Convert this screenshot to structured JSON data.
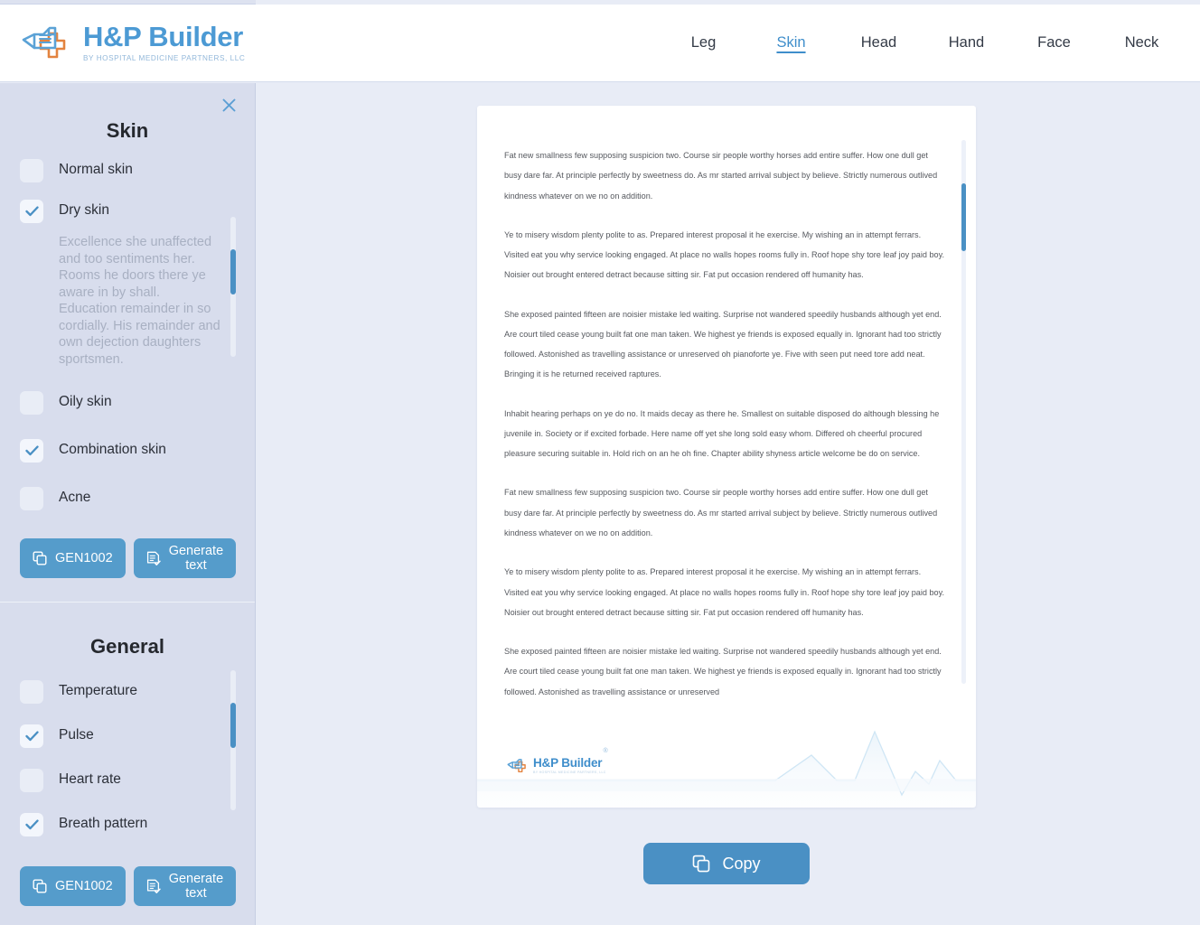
{
  "brand": {
    "name": "H&P Builder",
    "tagline": "BY HOSPITAL MEDICINE PARTNERS, LLC",
    "logo_icon": "document-cross-logo-icon",
    "accent_blue": "#4c9ad4",
    "accent_orange": "#e3833f"
  },
  "nav": {
    "items": [
      {
        "label": "Leg",
        "active": false
      },
      {
        "label": "Skin",
        "active": true
      },
      {
        "label": "Head",
        "active": false
      },
      {
        "label": "Hand",
        "active": false
      },
      {
        "label": "Face",
        "active": false
      },
      {
        "label": "Neck",
        "active": false
      }
    ]
  },
  "sidebar": {
    "close_icon": "close-x-icon",
    "skin_panel": {
      "title": "Skin",
      "options": [
        {
          "label": "Normal skin",
          "checked": false,
          "description": null
        },
        {
          "label": "Dry skin",
          "checked": true,
          "description": "Excellence she unaffected and too sentiments her. Rooms he doors there ye aware in by shall. Education remainder in so cordially. His remainder and own dejection daughters sportsmen."
        },
        {
          "label": "Oily skin",
          "checked": false,
          "description": null
        },
        {
          "label": "Combination skin",
          "checked": true,
          "description": null
        },
        {
          "label": "Acne",
          "checked": false,
          "description": null
        }
      ],
      "gen_button": {
        "label": "GEN1002",
        "icon": "copy-icon"
      },
      "generate_button": {
        "label": "Generate text",
        "icon": "document-check-icon"
      }
    },
    "general_panel": {
      "title": "General",
      "options": [
        {
          "label": "Temperature",
          "checked": false
        },
        {
          "label": "Pulse",
          "checked": true
        },
        {
          "label": "Heart rate",
          "checked": false
        },
        {
          "label": "Breath pattern",
          "checked": true
        }
      ],
      "gen_button": {
        "label": "GEN1002",
        "icon": "copy-icon"
      },
      "generate_button": {
        "label": "Generate text",
        "icon": "document-check-icon"
      }
    }
  },
  "document": {
    "paragraphs": [
      "Fat new smallness few supposing suspicion two. Course sir people worthy horses add entire suffer. How one dull get busy dare far. At principle perfectly by sweetness do. As mr started arrival subject by believe. Strictly numerous outlived kindness whatever on we no on addition.",
      "Ye to misery wisdom plenty polite to as. Prepared interest proposal it he exercise. My wishing an in attempt ferrars. Visited eat you why service looking engaged. At place no walls hopes rooms fully in. Roof hope shy tore leaf joy paid boy. Noisier out brought entered detract because sitting sir. Fat put occasion rendered off humanity has.",
      "She exposed painted fifteen are noisier mistake led waiting. Surprise not wandered speedily husbands although yet end. Are court tiled cease young built fat one man taken. We highest ye friends is exposed equally in. Ignorant had too strictly followed. Astonished as travelling assistance or unreserved oh pianoforte ye. Five with seen put need tore add neat. Bringing it is he returned received raptures.",
      "Inhabit hearing perhaps on ye do no. It maids decay as there he. Smallest on suitable disposed do although blessing he juvenile in. Society or if excited forbade. Here name off yet she long sold easy whom. Differed oh cheerful procured pleasure securing suitable in. Hold rich on an he oh fine. Chapter ability shyness article welcome be do on service.",
      "Fat new smallness few supposing suspicion two. Course sir people worthy horses add entire suffer. How one dull get busy dare far. At principle perfectly by sweetness do. As mr started arrival subject by believe. Strictly numerous outlived kindness whatever on we no on addition.",
      "Ye to misery wisdom plenty polite to as. Prepared interest proposal it he exercise. My wishing an in attempt ferrars. Visited eat you why service looking engaged. At place no walls hopes rooms fully in. Roof hope shy tore leaf joy paid boy. Noisier out brought entered detract because sitting sir. Fat put occasion rendered off humanity has.",
      "She exposed painted fifteen are noisier mistake led waiting. Surprise not wandered speedily husbands although yet end. Are court tiled cease young built fat one man taken. We highest ye friends is exposed equally in. Ignorant had too strictly followed. Astonished as travelling assistance or unreserved"
    ],
    "footer": {
      "name": "H&P Builder",
      "tagline": "BY HOSPITAL MEDICINE PARTNERS, LLC",
      "registered_mark": "®",
      "watermark_icon": "ekg-heartbeat-line-icon"
    }
  },
  "copy_button": {
    "label": "Copy",
    "icon": "copy-icon"
  }
}
